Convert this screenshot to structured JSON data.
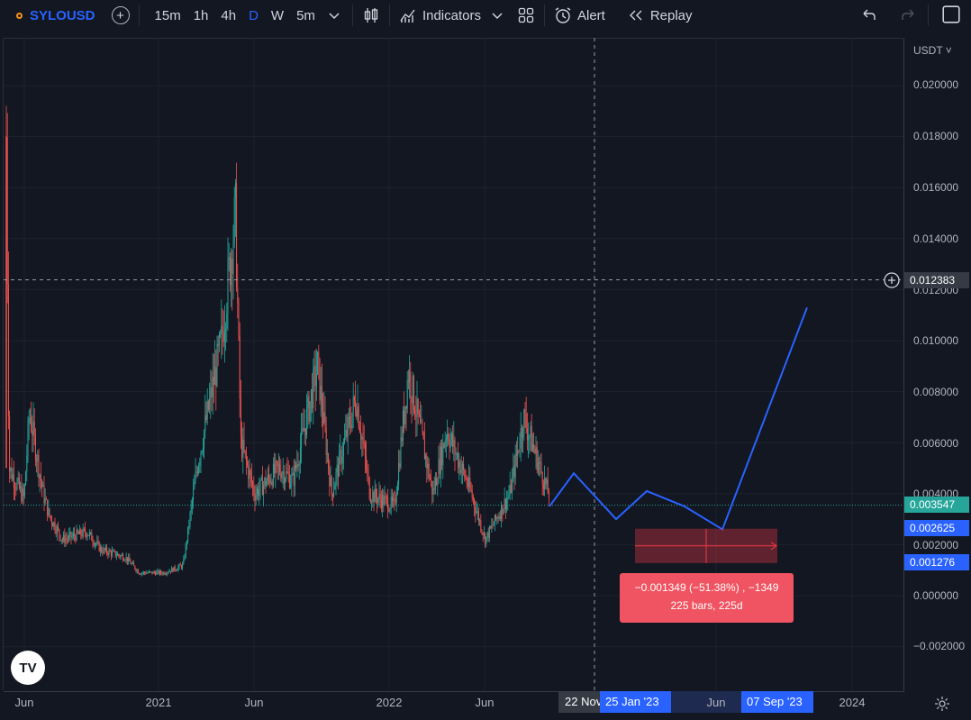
{
  "toolbar": {
    "symbol": "SYLOUSD",
    "add_symbol_icon": "plus-circle-icon",
    "timeframes": [
      "15m",
      "1h",
      "4h",
      "D",
      "W",
      "5m"
    ],
    "active_timeframe": "D",
    "chart_type_icon": "candles-icon",
    "indicators_label": "Indicators",
    "layouts_icon": "grid-icon",
    "alert_label": "Alert",
    "replay_label": "Replay",
    "undo_icon": "undo-icon",
    "redo_icon": "redo-icon",
    "fullscreen_icon": "square-icon"
  },
  "price_axis": {
    "currency": "USDT",
    "labels": [
      "0.020000",
      "0.018000",
      "0.016000",
      "0.014000",
      "0.012000",
      "0.010000",
      "0.008000",
      "0.006000",
      "0.004000",
      "0.002000",
      "0.000000",
      "−0.002000"
    ],
    "crosshair_price": "0.012383",
    "last_price": "0.003547",
    "range_top_price": "0.002625",
    "range_bottom_price": "0.001276",
    "colors": {
      "last": "#26a69a",
      "range": "#2962ff"
    }
  },
  "time_axis": {
    "labels": [
      "Jun",
      "2021",
      "Jun",
      "2022",
      "Jun",
      "Jun",
      "2024"
    ],
    "crosshair_date": "22 Nov",
    "range_start": "25 Jan '23",
    "range_end": "07 Sep '23"
  },
  "measure_tooltip": {
    "line1": "−0.001349 (−51.38%) , −1349",
    "line2": "225 bars, 225d",
    "color": "#f05361"
  },
  "colors": {
    "up": "#26a69a",
    "down": "#ef5350",
    "projection": "#2962ff",
    "background": "#131722"
  },
  "chart_data": {
    "type": "candlestick",
    "symbol": "SYLOUSD",
    "interval": "D",
    "ylim": [
      -0.0025,
      0.0205
    ],
    "close_path": [
      [
        "2020-05",
        0.018
      ],
      [
        "2020-05",
        0.005
      ],
      [
        "2020-06",
        0.0038
      ],
      [
        "2020-06",
        0.0072
      ],
      [
        "2020-07",
        0.004
      ],
      [
        "2020-07",
        0.0032
      ],
      [
        "2020-08",
        0.0022
      ],
      [
        "2020-09",
        0.0025
      ],
      [
        "2020-10",
        0.0018
      ],
      [
        "2020-11",
        0.0015
      ],
      [
        "2020-12",
        0.0009
      ],
      [
        "2021-01",
        0.0009
      ],
      [
        "2021-02",
        0.0011
      ],
      [
        "2021-02",
        0.0012
      ],
      [
        "2021-03",
        0.005
      ],
      [
        "2021-04",
        0.01
      ],
      [
        "2021-05",
        0.015
      ],
      [
        "2021-05",
        0.006
      ],
      [
        "2021-06",
        0.004
      ],
      [
        "2021-07",
        0.005
      ],
      [
        "2021-08",
        0.0045
      ],
      [
        "2021-09",
        0.009
      ],
      [
        "2021-10",
        0.004
      ],
      [
        "2021-11",
        0.0078
      ],
      [
        "2021-12",
        0.004
      ],
      [
        "2022-01",
        0.0035
      ],
      [
        "2022-02",
        0.0088
      ],
      [
        "2022-03",
        0.004
      ],
      [
        "2022-04",
        0.0065
      ],
      [
        "2022-05",
        0.004
      ],
      [
        "2022-06",
        0.0022
      ],
      [
        "2022-07",
        0.004
      ],
      [
        "2022-08",
        0.007
      ],
      [
        "2022-09",
        0.004
      ],
      [
        "2022-10",
        0.0035
      ]
    ],
    "projection_path": [
      [
        "2022-10",
        0.0035
      ],
      [
        "2022-11",
        0.0048
      ],
      [
        "2022-12",
        0.003
      ],
      [
        "2023-01",
        0.0041
      ],
      [
        "2023-03",
        0.0035
      ],
      [
        "2023-06",
        0.0026
      ],
      [
        "2023-09",
        0.0113
      ]
    ],
    "measure": {
      "from_date": "25 Jan '23",
      "to_date": "07 Sep '23",
      "from_price": 0.002625,
      "to_price": 0.001276,
      "change": -0.001349,
      "change_pct": -51.38,
      "bars": 225
    }
  }
}
